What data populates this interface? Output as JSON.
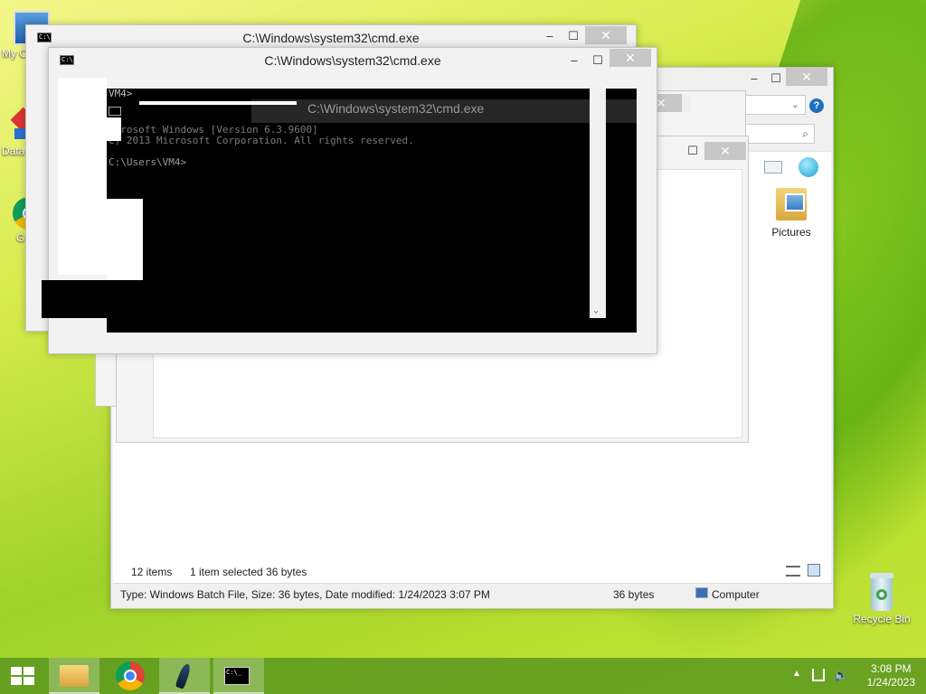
{
  "desktop": {
    "icons": [
      {
        "label": "My C"
      },
      {
        "label": "Data"
      },
      {
        "label": "G"
      },
      {
        "label": "Recycle Bin"
      }
    ]
  },
  "cmd_back": {
    "title": "C:\\Windows\\system32\\cmd.exe"
  },
  "cmd_front": {
    "title": "C:\\Windows\\system32\\cmd.exe",
    "lines": [
      "VM4>",
      "icrosoft Windows [Version 6.3.9600]",
      "c) 2013 Microsoft Corporation. All rights reserved.",
      "",
      "C:\\Users\\VM4>"
    ]
  },
  "cmd_ghost": {
    "title": "C:\\Windows\\system32\\cmd.exe"
  },
  "explorer": {
    "folder_item": "Pictures",
    "status": {
      "items": "12 items",
      "selected": "1 item selected  36 bytes"
    },
    "details": {
      "info": "Type: Windows Batch File, Size: 36 bytes, Date modified: 1/24/2023 3:07 PM",
      "size": "36 bytes",
      "location": "Computer"
    }
  },
  "taskbar": {
    "time": "3:08 PM",
    "date": "1/24/2023"
  },
  "colors": {
    "console_bg": "#000000",
    "taskbar": "#5a961e",
    "close_button": "#c7c7c7"
  }
}
